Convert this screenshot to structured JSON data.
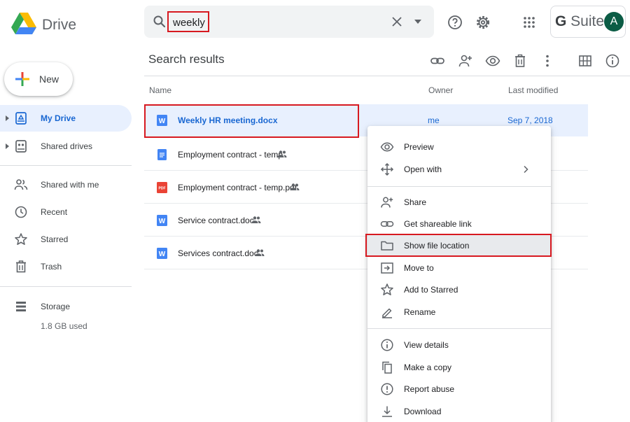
{
  "app": {
    "name": "Drive"
  },
  "search": {
    "value": "weekly"
  },
  "account": {
    "brand_bold": "G",
    "brand_rest": " Suite",
    "avatar_letter": "A"
  },
  "sidebar": {
    "new_label": "New",
    "items": [
      {
        "label": "My Drive",
        "icon": "my-drive-icon",
        "active": true
      },
      {
        "label": "Shared drives",
        "icon": "shared-drives-icon"
      },
      {
        "label": "Shared with me",
        "icon": "people-icon"
      },
      {
        "label": "Recent",
        "icon": "clock-icon"
      },
      {
        "label": "Starred",
        "icon": "star-icon"
      },
      {
        "label": "Trash",
        "icon": "trash-icon"
      },
      {
        "label": "Storage",
        "icon": "storage-icon"
      }
    ],
    "storage_used": "1.8 GB used"
  },
  "main": {
    "title": "Search results",
    "columns": {
      "name": "Name",
      "owner": "Owner",
      "modified": "Last modified"
    },
    "files": [
      {
        "name": "Weekly HR meeting.docx",
        "type": "word",
        "shared": false,
        "owner": "me",
        "modified": "Sep 7, 2018",
        "selected": true
      },
      {
        "name": "Employment contract - temp",
        "type": "gdoc",
        "shared": true
      },
      {
        "name": "Employment contract - temp.pdf",
        "type": "pdf",
        "shared": true
      },
      {
        "name": "Service contract.doc",
        "type": "word",
        "shared": true
      },
      {
        "name": "Services contract.doc",
        "type": "word",
        "shared": true
      }
    ]
  },
  "context_menu": {
    "items": [
      {
        "label": "Preview",
        "icon": "eye-icon"
      },
      {
        "label": "Open with",
        "icon": "open-with-icon",
        "submenu": true
      },
      {
        "label": "Share",
        "icon": "add-person-icon"
      },
      {
        "label": "Get shareable link",
        "icon": "link-icon"
      },
      {
        "label": "Show file location",
        "icon": "folder-icon",
        "highlighted": true
      },
      {
        "label": "Move to",
        "icon": "move-to-icon"
      },
      {
        "label": "Add to Starred",
        "icon": "star-icon"
      },
      {
        "label": "Rename",
        "icon": "pencil-icon"
      },
      {
        "label": "View details",
        "icon": "info-icon"
      },
      {
        "label": "Make a copy",
        "icon": "copy-icon"
      },
      {
        "label": "Report abuse",
        "icon": "report-icon"
      },
      {
        "label": "Download",
        "icon": "download-icon"
      }
    ]
  },
  "colors": {
    "accent": "#1967d2",
    "selection": "#e8f0fe",
    "annotation": "#d71920",
    "word": "#4285f4",
    "pdf": "#ea4335"
  }
}
